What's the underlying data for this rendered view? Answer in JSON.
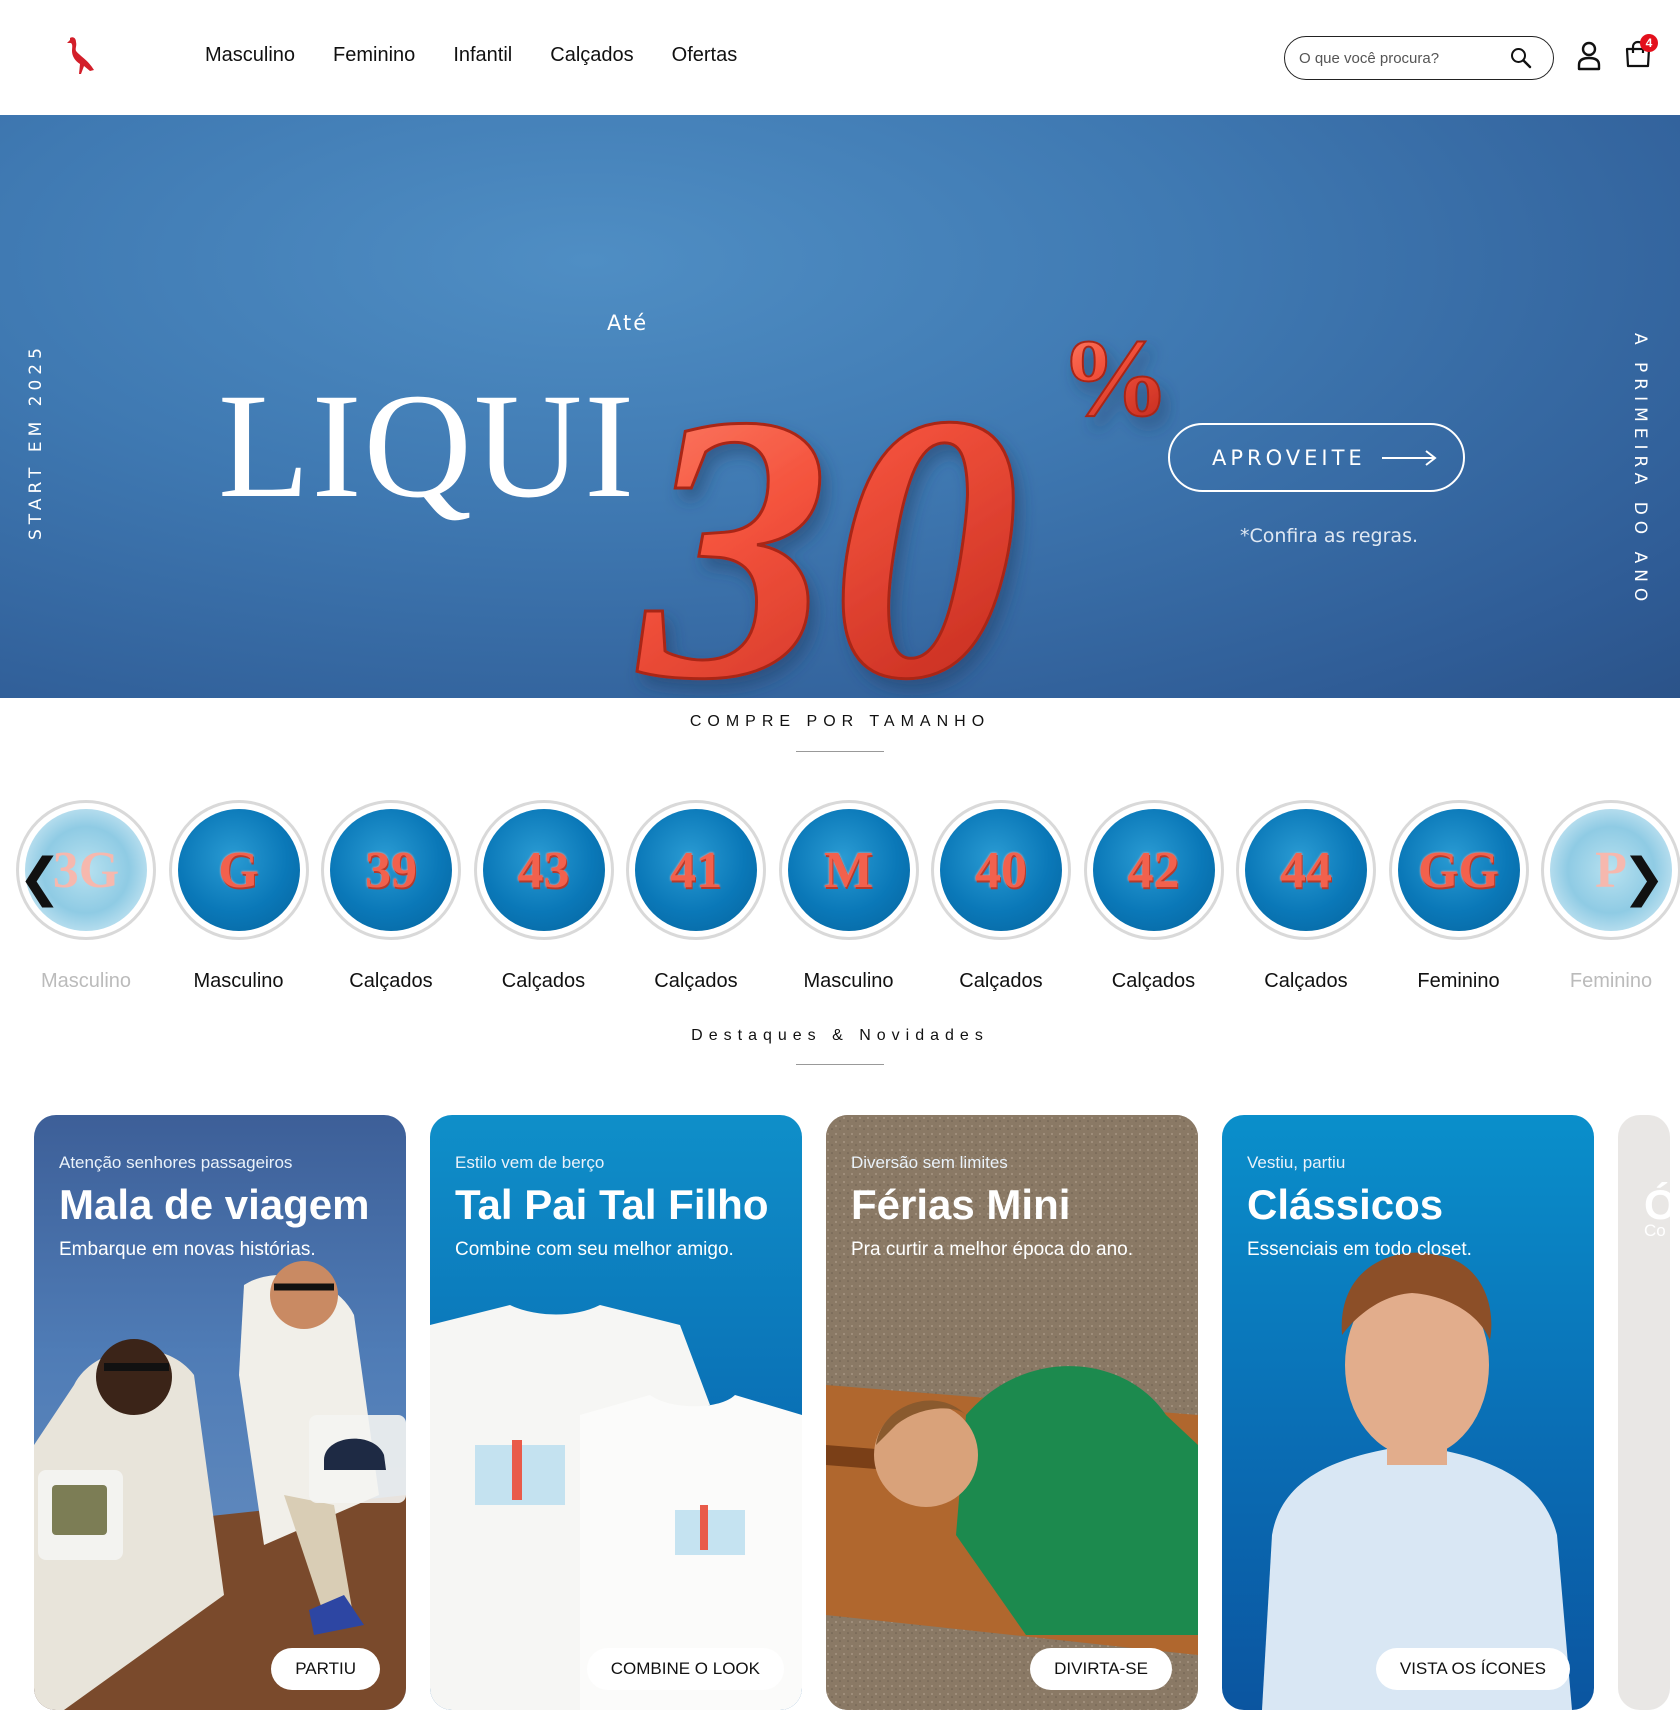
{
  "header": {
    "nav": [
      "Masculino",
      "Feminino",
      "Infantil",
      "Calçados",
      "Ofertas"
    ],
    "search_placeholder": "O que você procura?",
    "cart_count": "4"
  },
  "hero": {
    "side_left": "START EM 2025",
    "side_right": "A PRIMEIRA DO ANO",
    "word": "LIQUI",
    "prefix": "Até",
    "number": "30",
    "percent": "%",
    "cta": "APROVEITE",
    "rules": "*Confira as regras.",
    "colors": {
      "background": "#3f79b2",
      "accent": "#f2614d"
    }
  },
  "sizes": {
    "title": "COMPRE POR TAMANHO",
    "prev": "❮",
    "next": "❯",
    "items": [
      {
        "size": "3G",
        "label": "Masculino"
      },
      {
        "size": "G",
        "label": "Masculino"
      },
      {
        "size": "39",
        "label": "Calçados"
      },
      {
        "size": "43",
        "label": "Calçados"
      },
      {
        "size": "41",
        "label": "Calçados"
      },
      {
        "size": "M",
        "label": "Masculino"
      },
      {
        "size": "40",
        "label": "Calçados"
      },
      {
        "size": "42",
        "label": "Calçados"
      },
      {
        "size": "44",
        "label": "Calçados"
      },
      {
        "size": "GG",
        "label": "Feminino"
      },
      {
        "size": "P",
        "label": "Feminino"
      }
    ]
  },
  "highlights": {
    "title": "Destaques & Novidades",
    "cards": [
      {
        "eyebrow": "Atenção senhores passageiros",
        "title": "Mala de viagem",
        "subtitle": "Embarque em novas histórias.",
        "button": "PARTIU"
      },
      {
        "eyebrow": "Estilo vem de berço",
        "title": "Tal Pai Tal Filho",
        "subtitle": "Combine com seu melhor amigo.",
        "button": "COMBINE O LOOK"
      },
      {
        "eyebrow": "Diversão sem limites",
        "title": "Férias Mini",
        "subtitle": "Pra curtir a melhor época do ano.",
        "button": "DIVIRTA-SE"
      },
      {
        "eyebrow": "Vestiu, partiu",
        "title": "Clássicos",
        "subtitle": "Essenciais em todo closet.",
        "button": "VISTA OS ÍCONES"
      },
      {
        "eyebrow": "Co",
        "title": "Ó",
        "subtitle": "",
        "button": ""
      }
    ]
  }
}
